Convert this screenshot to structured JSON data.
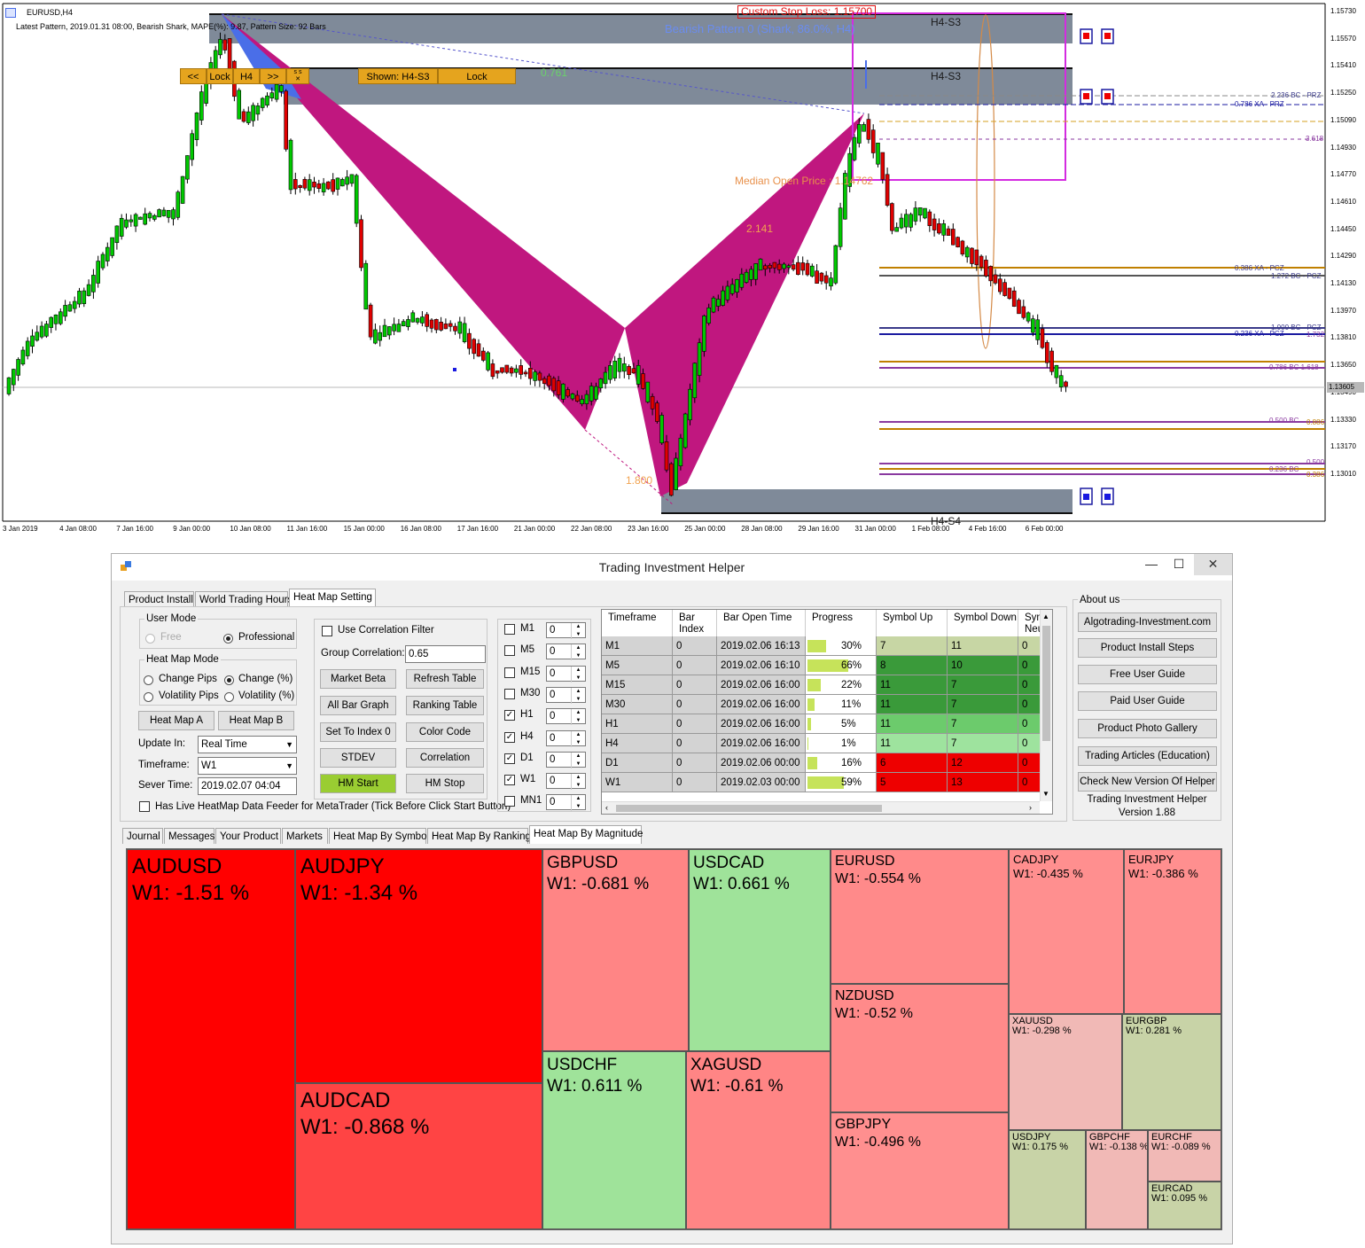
{
  "chart": {
    "symbol_tf": "EURUSD,H4",
    "pattern_info": "Latest Pattern, 2019.01.31 08:00, Bearish Shark, MAPE(%): 9.87, Pattern Size: 92 Bars",
    "custom_stop_loss": "Custom Stop Loss: 1.15700",
    "bearish_pattern": "Bearish Pattern 0  (Shark,  86.0%, H4)",
    "zone_upper_label": "H4-S3",
    "zone_mid_label": "H4-S3",
    "zone_lower_label": "H4-S4",
    "ratio_0761": "0.761",
    "ratio_2141": "2.141",
    "ratio_1800": "1.800",
    "median_open": "Median Open Price : 1.14762",
    "current_price": "1.13605",
    "price_ticks": [
      "1.15730",
      "1.15570",
      "1.15410",
      "1.15250",
      "1.15090",
      "1.14930",
      "1.14770",
      "1.14610",
      "1.14450",
      "1.14290",
      "1.14130",
      "1.13970",
      "1.13810",
      "1.13650",
      "1.13490",
      "1.13330",
      "1.13170",
      "1.13010"
    ],
    "time_ticks": [
      "3 Jan 2019",
      "4 Jan 08:00",
      "7 Jan 16:00",
      "9 Jan 00:00",
      "10 Jan 08:00",
      "11 Jan 16:00",
      "15 Jan 00:00",
      "16 Jan 08:00",
      "17 Jan 16:00",
      "21 Jan 00:00",
      "22 Jan 08:00",
      "23 Jan 16:00",
      "25 Jan 00:00",
      "28 Jan 08:00",
      "29 Jan 16:00",
      "31 Jan 00:00",
      "1 Feb 08:00",
      "4 Feb 16:00",
      "6 Feb 00:00"
    ],
    "line_labels": [
      {
        "text": "2.236 BC - PRZ",
        "color": "#3a3a8a"
      },
      {
        "text": "0.786 XA - PRZ",
        "color": "#1a1aa0"
      },
      {
        "text": "3.618",
        "color": "#8a3aa0"
      },
      {
        "text": "0.386 XA - PCZ",
        "color": "#3a3a8a"
      },
      {
        "text": "1.272 BC - PCZ",
        "color": "#3a3a8a"
      },
      {
        "text": "1.000 BC - PCZ",
        "color": "#3a3a8a"
      },
      {
        "text": "0.236 XA - PCZ",
        "color": "#1a1aa0"
      },
      {
        "text": "1.732",
        "color": "#8a3aa0"
      },
      {
        "text": "0.786 BC 1.618",
        "color": "#8a3aa0"
      },
      {
        "text": "0.500 BC",
        "color": "#8a3aa0"
      },
      {
        "text": "0.886",
        "color": "#c08000"
      },
      {
        "text": "0.500",
        "color": "#8a3aa0"
      },
      {
        "text": "0.236 BC",
        "color": "#8a3aa0"
      },
      {
        "text": "0.386",
        "color": "#c08000"
      }
    ],
    "overlay_buttons": [
      "<<",
      "Lock",
      "H4",
      ">>",
      "Shown: H4-S3",
      "Lock"
    ]
  },
  "app": {
    "title": "Trading Investment Helper",
    "top_tabs": [
      "Product Install",
      "World Trading Hours",
      "Heat Map Setting"
    ],
    "user_mode": {
      "title": "User Mode",
      "free": "Free",
      "professional": "Professional"
    },
    "heat_map_mode": {
      "title": "Heat Map Mode",
      "change_pips": "Change Pips",
      "change_pct": "Change (%)",
      "volatility_pips": "Volatility Pips",
      "volatility_pct": "Volatility (%)"
    },
    "heat_map_a": "Heat Map A",
    "heat_map_b": "Heat Map B",
    "update_in_label": "Update In:",
    "update_in_value": "Real Time",
    "timeframe_label": "Timeframe:",
    "timeframe_value": "W1",
    "server_time_label": "Sever Time:",
    "server_time_value": "2019.02.07 04:04",
    "feeder_check": "Has Live HeatMap Data Feeder for MetaTrader (Tick Before Click Start Button)",
    "use_corr_filter": "Use Correlation Filter",
    "group_corr_label": "Group Correlation:",
    "group_corr_value": "0.65",
    "buttons_mid": [
      "Market Beta",
      "Refresh Table",
      "All Bar Graph",
      "Ranking Table",
      "Set To Index 0",
      "Color Code",
      "STDEV",
      "Correlation",
      "HM Start",
      "HM Stop"
    ],
    "tf_checks": [
      {
        "label": "M1",
        "checked": false,
        "value": "0"
      },
      {
        "label": "M5",
        "checked": false,
        "value": "0"
      },
      {
        "label": "M15",
        "checked": false,
        "value": "0"
      },
      {
        "label": "M30",
        "checked": false,
        "value": "0"
      },
      {
        "label": "H1",
        "checked": true,
        "value": "0"
      },
      {
        "label": "H4",
        "checked": true,
        "value": "0"
      },
      {
        "label": "D1",
        "checked": true,
        "value": "0"
      },
      {
        "label": "W1",
        "checked": true,
        "value": "0"
      },
      {
        "label": "MN1",
        "checked": false,
        "value": "0"
      }
    ],
    "table": {
      "headers": [
        "Timeframe",
        "Bar Index",
        "Bar Open Time",
        "Progress",
        "Symbol Up",
        "Symbol Down",
        "Symbol Neutral"
      ],
      "rows": [
        {
          "tf": "M1",
          "idx": "0",
          "time": "2019.02.06 16:13",
          "progress": 0.3,
          "progress_text": "30%",
          "up": "7",
          "down": "11",
          "neutral": "0",
          "color": "#c7d6a4"
        },
        {
          "tf": "M5",
          "idx": "0",
          "time": "2019.02.06 16:10",
          "progress": 0.66,
          "progress_text": "66%",
          "up": "8",
          "down": "10",
          "neutral": "0",
          "color": "#3a9a3a"
        },
        {
          "tf": "M15",
          "idx": "0",
          "time": "2019.02.06 16:00",
          "progress": 0.22,
          "progress_text": "22%",
          "up": "11",
          "down": "7",
          "neutral": "0",
          "color": "#3a9a3a"
        },
        {
          "tf": "M30",
          "idx": "0",
          "time": "2019.02.06 16:00",
          "progress": 0.11,
          "progress_text": "11%",
          "up": "11",
          "down": "7",
          "neutral": "0",
          "color": "#3a9a3a"
        },
        {
          "tf": "H1",
          "idx": "0",
          "time": "2019.02.06 16:00",
          "progress": 0.05,
          "progress_text": "5%",
          "up": "11",
          "down": "7",
          "neutral": "0",
          "color": "#6ccb6c"
        },
        {
          "tf": "H4",
          "idx": "0",
          "time": "2019.02.06 16:00",
          "progress": 0.01,
          "progress_text": "1%",
          "up": "11",
          "down": "7",
          "neutral": "0",
          "color": "#9ee39e"
        },
        {
          "tf": "D1",
          "idx": "0",
          "time": "2019.02.06 00:00",
          "progress": 0.16,
          "progress_text": "16%",
          "up": "6",
          "down": "12",
          "neutral": "0",
          "color": "#ee0000"
        },
        {
          "tf": "W1",
          "idx": "0",
          "time": "2019.02.03 00:00",
          "progress": 0.59,
          "progress_text": "59%",
          "up": "5",
          "down": "13",
          "neutral": "0",
          "color": "#ee0000"
        }
      ]
    },
    "about_title": "About us",
    "about_buttons": [
      "Algotrading-Investment.com",
      "Product Install Steps",
      "Free User Guide",
      "Paid User Guide",
      "Product Photo Gallery",
      "Trading Articles (Education)",
      "Check New Version Of Helper"
    ],
    "version_line1": "Trading Investment Helper",
    "version_line2": "Version 1.88",
    "bottom_tabs": [
      "Journal",
      "Messages",
      "Your Product",
      "Markets",
      "Heat Map By Symbol",
      "Heat Map By Ranking",
      "Heat Map By Magnitude"
    ]
  },
  "heatmap": [
    {
      "symbol": "AUDUSD",
      "value": "W1: -1.51 %",
      "color": "#ff0000",
      "size": "xl"
    },
    {
      "symbol": "AUDJPY",
      "value": "W1: -1.34 %",
      "color": "#ff0000",
      "size": "xl"
    },
    {
      "symbol": "AUDCAD",
      "value": "W1: -0.868 %",
      "color": "#ff4444",
      "size": "xl"
    },
    {
      "symbol": "GBPUSD",
      "value": "W1: -0.681 %",
      "color": "#ff8585",
      "size": "l"
    },
    {
      "symbol": "USDCAD",
      "value": "W1: 0.661 %",
      "color": "#9fe39a",
      "size": "l"
    },
    {
      "symbol": "USDCHF",
      "value": "W1: 0.611 %",
      "color": "#9fe39a",
      "size": "l"
    },
    {
      "symbol": "XAGUSD",
      "value": "W1: -0.61 %",
      "color": "#ff8585",
      "size": "l"
    },
    {
      "symbol": "EURUSD",
      "value": "W1: -0.554 %",
      "color": "#ff8a8a",
      "size": "m"
    },
    {
      "symbol": "NZDUSD",
      "value": "W1: -0.52 %",
      "color": "#ff8a8a",
      "size": "m"
    },
    {
      "symbol": "GBPJPY",
      "value": "W1: -0.496 %",
      "color": "#ff8f8f",
      "size": "m"
    },
    {
      "symbol": "CADJPY",
      "value": "W1: -0.435 %",
      "color": "#ff8f8f",
      "size": "s"
    },
    {
      "symbol": "EURJPY",
      "value": "W1: -0.386 %",
      "color": "#ff8f8f",
      "size": "s"
    },
    {
      "symbol": "XAUUSD",
      "value": "W1: -0.298 %",
      "color": "#f1b9b6",
      "size": "xs"
    },
    {
      "symbol": "EURGBP",
      "value": "W1: 0.281 %",
      "color": "#c8d3a7",
      "size": "xs"
    },
    {
      "symbol": "USDJPY",
      "value": "W1: 0.175 %",
      "color": "#c8d3a7",
      "size": "xs"
    },
    {
      "symbol": "GBPCHF",
      "value": "W1: -0.138 %",
      "color": "#f1b9b6",
      "size": "xs"
    },
    {
      "symbol": "EURCHF",
      "value": "W1: -0.089 %",
      "color": "#f1b9b6",
      "size": "xs"
    },
    {
      "symbol": "EURCAD",
      "value": "W1: 0.095 %",
      "color": "#c8d3a7",
      "size": "xs"
    }
  ]
}
